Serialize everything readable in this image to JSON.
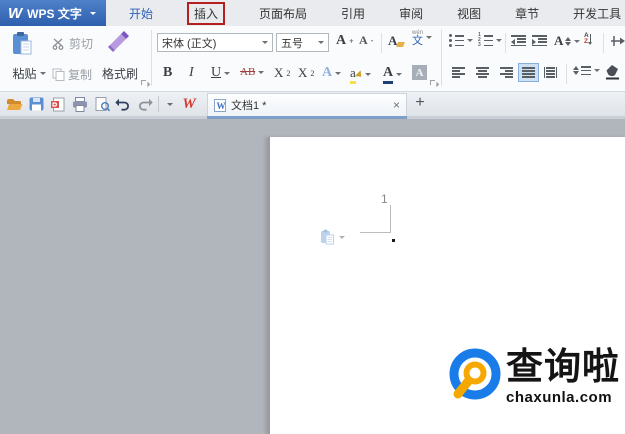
{
  "app": {
    "logo": "W",
    "title": "WPS 文字"
  },
  "menu": {
    "tabs": [
      {
        "label": "开始"
      },
      {
        "label": "插入"
      },
      {
        "label": "页面布局"
      },
      {
        "label": "引用"
      },
      {
        "label": "审阅"
      },
      {
        "label": "视图"
      },
      {
        "label": "章节"
      },
      {
        "label": "开发工具"
      }
    ]
  },
  "ribbon": {
    "paste": "粘贴",
    "cut": "剪切",
    "copy": "复制",
    "format_painter": "格式刷",
    "font_family": "宋体 (正文)",
    "font_size": "五号",
    "grow": "A",
    "grow_sup": "+",
    "shrink": "A",
    "shrink_sup": "-",
    "clear": "A",
    "pinyin_top": "wén",
    "pinyin_char": "文",
    "bold": "B",
    "italic": "I",
    "underline": "U",
    "strike": "AB",
    "sup_base": "X",
    "sup_exp": "2",
    "sub_base": "X",
    "sub_idx": "2",
    "effects": "A",
    "highlight": "a",
    "font_color": "A",
    "shading": "A",
    "scale": "A",
    "sort_a": "A",
    "sort_z": "Z"
  },
  "tabbar": {
    "document": "文档1 *",
    "close": "×",
    "new_tab": "+"
  },
  "doc": {
    "number": "1",
    "dot": "."
  },
  "watermark": {
    "name": "查询啦",
    "domain": "chaxunla.com"
  },
  "colors": {
    "wps_blue": "#2d5fae",
    "active_tab_text": "#2e62b8",
    "annotation_red": "#b42020",
    "tab_underline": "#7e9fc9",
    "workspace_gray": "#b1b5bc",
    "watermark_blue": "#1a7ce8",
    "watermark_orange": "#f7a800",
    "wps_logo_red": "#d43a2f"
  }
}
